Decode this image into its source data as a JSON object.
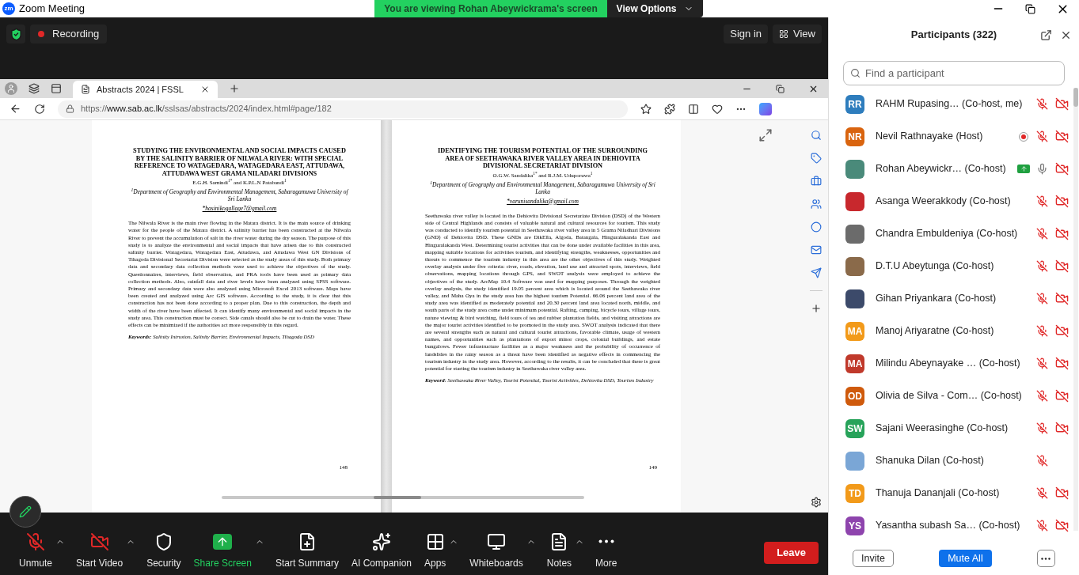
{
  "title_bar": {
    "logo_text": "zm",
    "title": "Zoom Meeting"
  },
  "share_banner": {
    "text": "You are viewing Rohan Abeywickrama's screen",
    "button": "View Options"
  },
  "meeting_bar": {
    "recording": "Recording",
    "sign_in": "Sign in",
    "view": "View"
  },
  "browser": {
    "tab_title": "Abstracts 2024 | FSSL",
    "url_prefix": "https://",
    "url_host": "www.sab.ac.lk",
    "url_path": "/sslsas/abstracts/2024/index.html#page/182",
    "pages": [
      {
        "title": "STUDYING THE ENVIRONMENTAL AND SOCIAL IMPACTS CAUSED BY THE SALINITY BARRIER OF NILWALA RIVER: WITH SPECIAL REFERENCE TO WATAGEDARA, WATAGEDARA EAST, ATTUDAWA, ATTUDAWA WEST GRAMA NILADARI DIVISIONS",
        "authors": "E.G.H. Samindi$^{1*}$ and K.P.L.N Patabandi$^{1}$",
        "affiliation": "$^{1}$Department of Geography and Environmental Management, Sabaragamuwa University of Sri Lanka",
        "email": "*hasinikogallage7@gmail.com",
        "abstract": "The Nilwala River is the main river flowing in the Matara district. It is the main source of drinking water for the people of the Matara district. A salinity barrier has been constructed at the Nilwala River to prevent the accumulation of salt in the river water during the dry season. The purpose of this study is to analyze the environmental and social impacts that have arisen due to this constructed salinity barrier. Watagedara, Watagedara East, Attudawa, and Attudawa West GN Divisions of Tihagoda Divisional Secretariat Division were selected as the study areas of this study. Both primary data and secondary data collection methods were used to achieve the objectives of the study. Questionnaires, interviews, field observation, and PRA tools have been used as primary data collection methods. Also, rainfall data and river levels have been analyzed using SPSS software. Primary and secondary data were also analyzed using Microsoft Excel 2013 software. Maps have been created and analyzed using Arc GIS software. According to the study, it is clear that this construction has not been done according to a proper plan. Due to this construction, the depth and width of the river have been affected. It can identify many environmental and social impacts in the study area. This construction must be correct. Side canals should also be cut to drain the water. These effects can be minimized if the authorities act more responsibly in this regard.",
        "keywords": "**Keywords:** Salinity Intrusion, Salinity Barrier, Environmental Impacts, Tihagoda DSD",
        "page_number": "148"
      },
      {
        "title": "IDENTIFYING THE TOURISM POTENTIAL OF THE SURROUNDING AREA OF SEETHAWAKA RIVER VALLEY AREA IN DEHIOVITA DIVISIONAL SECRETARIAT DIVISION",
        "authors": "O.G.W. Sandalika$^{1*}$ and R.J.M. Uduporuwa$^{1}$",
        "affiliation": "$^{1}$Department of Geography and Environmental Management, Sabaragamuwa University of Sri Lanka",
        "email": "*varunisandalika@gmail.com",
        "abstract": "Seethawaka river valley is located in the Dehiovita Divisional Secretariate Division (DSD) of the Western side of Central Highlands and consists of valuable natural and cultural resources for tourism. This study was conducted to identify tourism potential in Seethawaka river valley area in 5 Grama Niladhari Divisions (GND) of Dehiovita DSD. These GNDs are DikElla, Algoda, Batangala, Hinguralakanda East and Hinguralakanda West. Determining tourist activities that can be done under available facilities in this area, mapping suitable locations for activities tourism, and identifying strengths, weaknesses, opportunities and threats to commence the tourism industry in this area are the other objectives of this study. Weighted overlay analysis under five criteria: river, roads, elevation, land use and attracted spots, interviews, field observations, mapping locations through GPS, and SWOT analysis were employed to achieve the objectives of the study. ArcMap 10.4 Software was used for mapping purposes. Through the weighted overlay analysis, the study identified 19.05 percent area which is located around the Seethawaka river valley, and Maha Oya in the study area has the highest tourism Potential. 66.06 percent land area of the study area was identified as moderately potential and 20.30 percent land area located north, middle, and south parts of the study area come under minimum potential. Rafting, camping, bicycle tours, village tours, nature viewing & bird watching, field tours of tea and rubber plantation fields, and visiting attractions are the major tourist activities identified to be promoted in the study area. SWOT analysis indicated that there are several strengths such as natural and cultural tourist attractions, favorable climate, usage of western names, and opportunities such as plantations of export minor crops, colonial buildings, and estate bungalows. Fewer infrastructure facilities as a major weakness and the probability of occurrence of landslides in the rainy season as a threat have been identified as negative effects in commencing the tourism industry in the study area. However, according to the results, it can be concluded that there is great potential for starting the tourism industry in Seethawaka river valley area.",
        "keywords": "**Keyword**: Seethawaka River Valley, Tourist Potential, Tourist Activities, Dehiovita DSD, Tourism Industry",
        "page_number": "149"
      }
    ]
  },
  "toolbar": [
    {
      "kind": "mic",
      "label": "Unmute",
      "off": true,
      "caret": true,
      "active": false
    },
    {
      "kind": "video",
      "label": "Start Video",
      "off": true,
      "caret": true,
      "active": false
    },
    {
      "kind": "security",
      "label": "Security",
      "caret": false,
      "active": false
    },
    {
      "kind": "share",
      "label": "Share Screen",
      "caret": true,
      "active": true
    },
    {
      "kind": "summary",
      "label": "Start Summary",
      "caret": false,
      "active": false
    },
    {
      "kind": "ai",
      "label": "AI Companion",
      "caret": false,
      "active": false
    },
    {
      "kind": "apps",
      "label": "Apps",
      "caret": true,
      "active": false
    },
    {
      "kind": "whiteboards",
      "label": "Whiteboards",
      "caret": true,
      "active": false
    },
    {
      "kind": "notes",
      "label": "Notes",
      "caret": true,
      "active": false
    },
    {
      "kind": "more",
      "label": "More",
      "caret": false,
      "active": false
    }
  ],
  "leave_button": "Leave",
  "participants": {
    "title": "Participants (322)",
    "search_placeholder": "Find a participant",
    "items": [
      {
        "name": "RAHM Rupasing…",
        "role": "(Co-host, me)",
        "avatar": {
          "kind": "initials",
          "initials": "RR",
          "color": "#2e7dbd"
        },
        "recording": false,
        "sharing": false,
        "mic_muted": true,
        "has_camera": true,
        "camera_off": true
      },
      {
        "name": "Nevil Rathnayake",
        "role": "(Host)",
        "avatar": {
          "kind": "initials",
          "initials": "NR",
          "color": "#d9640f"
        },
        "recording": true,
        "sharing": false,
        "mic_muted": true,
        "has_camera": true,
        "camera_off": true
      },
      {
        "name": "Rohan Abeywickr…",
        "role": "(Co-host)",
        "avatar": {
          "kind": "photo",
          "color": "#4a8a7a"
        },
        "recording": false,
        "sharing": true,
        "mic_muted": false,
        "has_camera": true,
        "camera_off": true
      },
      {
        "name": "Asanga Weerakkody",
        "role": "(Co-host)",
        "avatar": {
          "kind": "photo",
          "color": "#c8282d"
        },
        "recording": false,
        "sharing": false,
        "mic_muted": true,
        "has_camera": true,
        "camera_off": true
      },
      {
        "name": "Chandra Embuldeniya",
        "role": "(Co-host)",
        "avatar": {
          "kind": "photo",
          "color": "#6b6b6b"
        },
        "recording": false,
        "sharing": false,
        "mic_muted": true,
        "has_camera": true,
        "camera_off": true
      },
      {
        "name": "D.T.U Abeytunga",
        "role": "(Co-host)",
        "avatar": {
          "kind": "photo",
          "color": "#8a6a4a"
        },
        "recording": false,
        "sharing": false,
        "mic_muted": true,
        "has_camera": true,
        "camera_off": true
      },
      {
        "name": "Gihan Priyankara",
        "role": "(Co-host)",
        "avatar": {
          "kind": "photo",
          "color": "#3c4a6a"
        },
        "recording": false,
        "sharing": false,
        "mic_muted": true,
        "has_camera": true,
        "camera_off": true
      },
      {
        "name": "Manoj Ariyaratne",
        "role": "(Co-host)",
        "avatar": {
          "kind": "initials",
          "initials": "MA",
          "color": "#f29a1a"
        },
        "recording": false,
        "sharing": false,
        "mic_muted": true,
        "has_camera": true,
        "camera_off": true
      },
      {
        "name": "Milindu Abeynayake …",
        "role": "(Co-host)",
        "avatar": {
          "kind": "initials",
          "initials": "MA",
          "color": "#c0392b"
        },
        "recording": false,
        "sharing": false,
        "mic_muted": true,
        "has_camera": true,
        "camera_off": true
      },
      {
        "name": "Olivia de Silva - Com…",
        "role": "(Co-host)",
        "avatar": {
          "kind": "initials",
          "initials": "OD",
          "color": "#cf5a0c"
        },
        "recording": false,
        "sharing": false,
        "mic_muted": true,
        "has_camera": true,
        "camera_off": true
      },
      {
        "name": "Sajani Weerasinghe",
        "role": "(Co-host)",
        "avatar": {
          "kind": "initials",
          "initials": "SW",
          "color": "#27a35a"
        },
        "recording": false,
        "sharing": false,
        "mic_muted": true,
        "has_camera": true,
        "camera_off": true
      },
      {
        "name": "Shanuka Dilan",
        "role": "(Co-host)",
        "avatar": {
          "kind": "photo",
          "color": "#7aa6d6"
        },
        "recording": false,
        "sharing": false,
        "mic_muted": true,
        "has_camera": false
      },
      {
        "name": "Thanuja Dananjali",
        "role": "(Co-host)",
        "avatar": {
          "kind": "initials",
          "initials": "TD",
          "color": "#f29a1a"
        },
        "recording": false,
        "sharing": false,
        "mic_muted": true,
        "has_camera": true,
        "camera_off": true
      },
      {
        "name": "Yasantha subash Sa…",
        "role": "(Co-host)",
        "avatar": {
          "kind": "initials",
          "initials": "YS",
          "color": "#8e44ad"
        },
        "recording": false,
        "sharing": false,
        "mic_muted": true,
        "has_camera": true,
        "camera_off": true
      }
    ],
    "buttons": {
      "invite": "Invite",
      "mute_all": "Mute All"
    }
  }
}
